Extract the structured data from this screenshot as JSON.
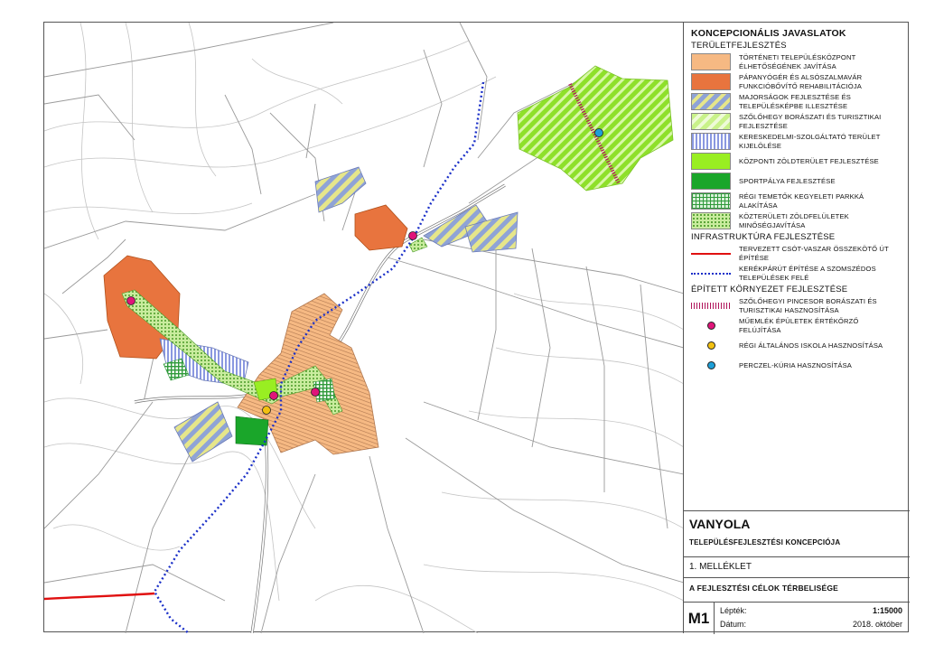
{
  "legend": {
    "title": "KONCEPCIONÁLIS JAVASLATOK",
    "sections": [
      {
        "title": "TERÜLETFEJLESZTÉS",
        "items": [
          {
            "label": "TÖRTÉNETI TELEPÜLÉSKÖZPONT ÉLHETŐSÉGÉNEK JAVÍTÁSA",
            "style": "orange-light",
            "color": "#f6b983"
          },
          {
            "label": "PÁPANYÓGÉR ÉS ALSÓSZALMAVÁR FUNKCIÓBŐVÍTŐ REHABILITÁCIÓJA",
            "style": "orange-dark",
            "color": "#e8743e"
          },
          {
            "label": "MAJORSÁGOK FEJLESZTÉSE ÉS TELEPÜLÉSKÉPBE ILLESZTÉSE",
            "style": "stripe-blue-yellow",
            "color": "#8fa3d6"
          },
          {
            "label": "SZŐLŐHEGY BORÁSZATI ÉS TURISZTIKAI FEJLESZTÉSE",
            "style": "stripe-green-light",
            "color": "#c9f28a"
          },
          {
            "label": "KERESKEDELMI-SZOLGÁLTATÓ TERÜLET KIJELÖLÉSE",
            "style": "vstripe-blue",
            "color": "#8a98e0"
          },
          {
            "label": "KÖZPONTI ZÖLDTERÜLET FEJLESZTÉSE",
            "style": "solid-lime",
            "color": "#99ee22"
          },
          {
            "label": "SPORTPÁLYA FEJLESZTÉSE",
            "style": "solid-green",
            "color": "#1aa62a"
          },
          {
            "label": "RÉGI TEMETŐK KEGYELETI PARKKÁ ALAKÍTÁSA",
            "style": "grid-green",
            "color": "#2f9a3a"
          },
          {
            "label": "KÖZTERÜLETI ZÖLDFELÜLETEK MINŐSÉGJAVÍTÁSA",
            "style": "dots-green",
            "color": "#7cc84a"
          }
        ]
      },
      {
        "title": "INFRASTRUKTÚRA FEJLESZTÉSE",
        "items": [
          {
            "label": "TERVEZETT CSÓT-VASZAR ÖSSZEKÖTŐ ÚT ÉPÍTÉSE",
            "style": "line-red",
            "color": "#e01010"
          },
          {
            "label": "KERÉKPÁRÚT ÉPÍTÉSE A SZOMSZÉDOS TELEPÜLÉSEK FELÉ",
            "style": "line-blue-dotted",
            "color": "#1a2fc8"
          }
        ]
      },
      {
        "title": "ÉPÍTETT KÖRNYEZET FEJLESZTÉSE",
        "items": [
          {
            "label": "SZŐLŐHEGYI PINCESOR BORÁSZATI ÉS TURISZTIKAI HASZNOSÍTÁSA",
            "style": "line-ticks",
            "color": "#b0135a"
          },
          {
            "label": "MŰEMLÉK ÉPÜLETEK ÉRTÉKŐRZŐ FELÚJÍTÁSA",
            "style": "point-magenta",
            "color": "#e0147a"
          },
          {
            "label": "RÉGI ÁLTALÁNOS ISKOLA HASZNOSÍTÁSA",
            "style": "point-yellow",
            "color": "#f2c010"
          },
          {
            "label": "PERCZEL-KÚRIA HASZNOSÍTÁSA",
            "style": "point-cyan",
            "color": "#1e9fd8"
          }
        ]
      }
    ]
  },
  "titleblock": {
    "settlement": "VANYOLA",
    "subtitle": "TELEPÜLÉSFEJLESZTÉSI KONCEPCIÓJA",
    "annex": "1. MELLÉKLET",
    "goal": "A FEJLESZTÉSI CÉLOK TÉRBELISÉGE",
    "code": "M1",
    "scale_label": "Lépték:",
    "scale_value": "1:15000",
    "date_label": "Dátum:",
    "date_value": "2018. október"
  }
}
